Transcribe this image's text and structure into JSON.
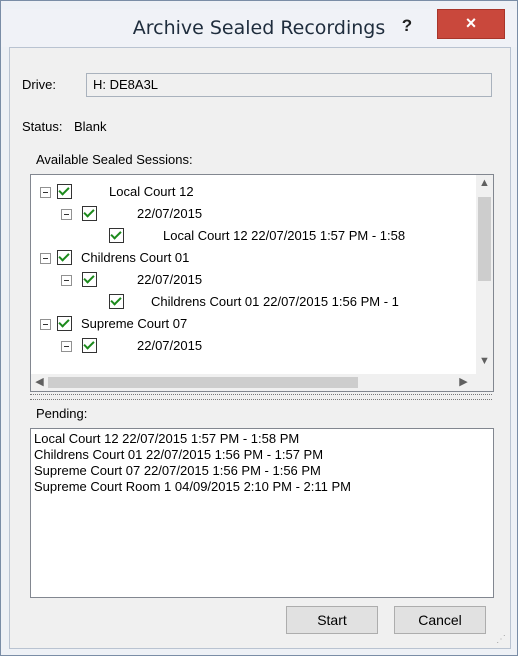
{
  "window": {
    "title": "Archive Sealed Recordings",
    "help_label": "?",
    "close_label": "×"
  },
  "drive": {
    "label": "Drive:",
    "value": "H: DE8A3L"
  },
  "status": {
    "label": "Status:",
    "value": "Blank"
  },
  "sessions": {
    "label": "Available Sealed Sessions:",
    "rows": [
      "Local Court 12",
      "22/07/2015",
      "Local Court 12 22/07/2015 1:57 PM - 1:58",
      "Childrens Court 01",
      "22/07/2015",
      "Childrens Court 01 22/07/2015 1:56 PM - 1",
      "Supreme Court 07",
      "22/07/2015"
    ]
  },
  "pending": {
    "label": "Pending:",
    "items": [
      "Local Court 12 22/07/2015 1:57 PM - 1:58 PM",
      "Childrens Court 01 22/07/2015 1:56 PM - 1:57 PM",
      "Supreme Court 07 22/07/2015 1:56 PM - 1:56 PM",
      "Supreme Court Room 1 04/09/2015 2:10 PM - 2:11 PM"
    ]
  },
  "buttons": {
    "start": "Start",
    "cancel": "Cancel"
  },
  "colors": {
    "close_button": "#c9483c",
    "check": "#1c8a1c"
  }
}
